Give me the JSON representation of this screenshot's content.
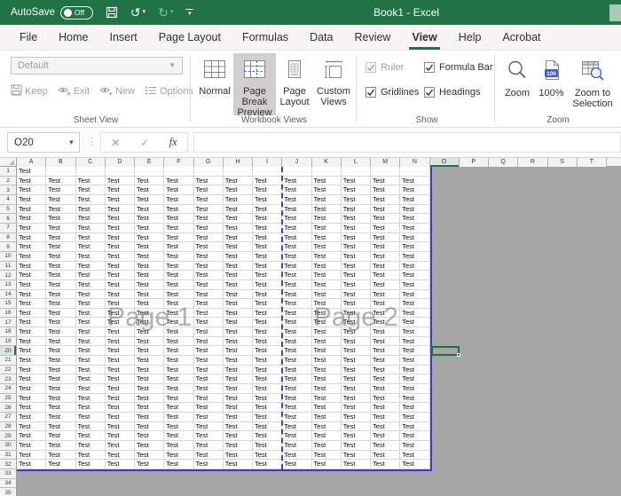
{
  "title_bar": {
    "autosave_label": "AutoSave",
    "autosave_state": "Off",
    "title": "Book1 - Excel",
    "qat_icons": [
      "save-icon",
      "undo-icon",
      "redo-icon",
      "customize-qat-icon"
    ]
  },
  "tabs": [
    {
      "label": "File"
    },
    {
      "label": "Home"
    },
    {
      "label": "Insert"
    },
    {
      "label": "Page Layout"
    },
    {
      "label": "Formulas"
    },
    {
      "label": "Data"
    },
    {
      "label": "Review"
    },
    {
      "label": "View",
      "active": true
    },
    {
      "label": "Help"
    },
    {
      "label": "Acrobat"
    }
  ],
  "ribbon": {
    "sheet_view": {
      "group_label": "Sheet View",
      "dropdown_value": "Default",
      "disabled": true,
      "buttons": [
        {
          "label": "Keep",
          "icon": "keep-icon"
        },
        {
          "label": "Exit",
          "icon": "exit-view-icon"
        },
        {
          "label": "New",
          "icon": "new-view-icon"
        },
        {
          "label": "Options",
          "icon": "options-icon"
        }
      ]
    },
    "workbook_views": {
      "group_label": "Workbook Views",
      "buttons": [
        {
          "label": "Normal",
          "icon": "normal-view-icon",
          "width": 42
        },
        {
          "label": "Page Break Preview",
          "icon": "page-break-preview-icon",
          "active": true,
          "width": 48
        },
        {
          "label": "Page Layout",
          "icon": "page-layout-icon",
          "width": 42
        },
        {
          "label": "Custom Views",
          "icon": "custom-views-icon",
          "width": 46
        }
      ]
    },
    "show": {
      "group_label": "Show",
      "checkboxes": [
        {
          "label": "Ruler",
          "checked": true,
          "disabled": true,
          "col": 0,
          "row": 0
        },
        {
          "label": "Formula Bar",
          "checked": true,
          "disabled": false,
          "col": 1,
          "row": 0
        },
        {
          "label": "Gridlines",
          "checked": true,
          "disabled": false,
          "col": 0,
          "row": 1
        },
        {
          "label": "Headings",
          "checked": true,
          "disabled": false,
          "col": 1,
          "row": 1
        }
      ]
    },
    "zoom": {
      "group_label": "Zoom",
      "buttons": [
        {
          "label": "Zoom",
          "icon": "zoom-icon",
          "width": 40
        },
        {
          "label": "100%",
          "icon": "zoom-100-icon",
          "width": 37
        },
        {
          "label": "Zoom to Selection",
          "icon": "zoom-to-selection-icon",
          "width": 56
        }
      ]
    }
  },
  "formula_bar": {
    "name_box_value": "O20",
    "formula_value": ""
  },
  "grid": {
    "column_headers": [
      "A",
      "B",
      "C",
      "D",
      "E",
      "F",
      "G",
      "H",
      "I",
      "J",
      "K",
      "L",
      "M",
      "N",
      "O",
      "P",
      "Q",
      "R",
      "S",
      "T"
    ],
    "row_count": 35,
    "cell_text": "Test",
    "filled_block": {
      "row_start": 2,
      "row_end": 32,
      "col_start_index": 0,
      "col_end_index": 13
    },
    "extra_filled_cells": [
      {
        "row": 1,
        "col_index": 0
      }
    ],
    "print_area": {
      "col_start_index": 0,
      "col_end_index": 13,
      "row_start": 1,
      "row_end": 32
    },
    "page_break_after_col_index": 8,
    "selected_cell": {
      "col_index": 14,
      "row": 20,
      "ref": "O20"
    },
    "watermarks": [
      {
        "text": "Page 1",
        "page": 1
      },
      {
        "text": "Page 2",
        "page": 2
      }
    ]
  },
  "colors": {
    "title_bar_green": "#217346",
    "accent_green": "#217346",
    "print_border_blue": "#3a3acc",
    "page_break_blue": "#4040cf",
    "outside_area_gray": "#a6a6a6",
    "selected_button_gray": "#d1cfcd",
    "watermark_gray": "#696969"
  }
}
